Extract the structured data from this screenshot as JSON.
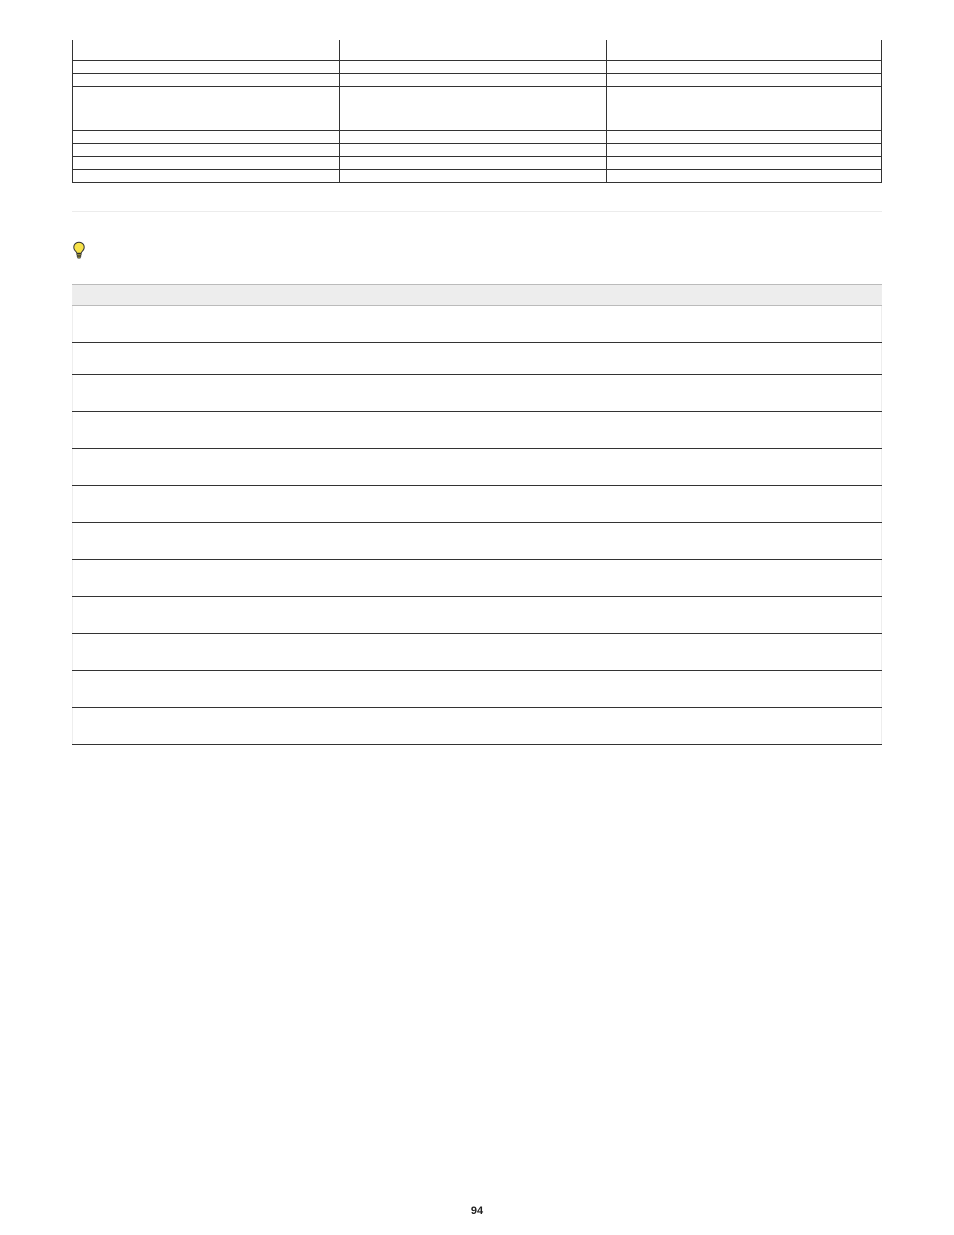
{
  "page_number": "94",
  "table1_rows": [
    {
      "c0": "",
      "c1": "",
      "c2": ""
    },
    {
      "c0": "",
      "c1": "",
      "c2": ""
    },
    {
      "c0": "",
      "c1": "",
      "c2": ""
    },
    {
      "c0": "",
      "c1": "",
      "c2": ""
    },
    {
      "c0": "",
      "c1": "",
      "c2": ""
    },
    {
      "c0": "",
      "c1": "",
      "c2": ""
    },
    {
      "c0": "",
      "c1": "",
      "c2": ""
    },
    {
      "c0": "",
      "c1": "",
      "c2": ""
    }
  ],
  "tip_text": "",
  "section_title": "",
  "table2_headers": {
    "h0": "",
    "h1": "",
    "h2": ""
  },
  "table2_rows": [
    {
      "c0": "",
      "c1": "",
      "c2": ""
    },
    {
      "c0": "",
      "c1": "",
      "c2": ""
    },
    {
      "c0": "",
      "c1": "",
      "c2": ""
    },
    {
      "c0": "",
      "c1": "",
      "c2": ""
    },
    {
      "c0": "",
      "c1": "",
      "c2": ""
    },
    {
      "c0": "",
      "c1": "",
      "c2": ""
    },
    {
      "c0": "",
      "c1": "",
      "c2": ""
    },
    {
      "c0": "",
      "c1": "",
      "c2": ""
    },
    {
      "c0": "",
      "c1": "",
      "c2": ""
    },
    {
      "c0": "",
      "c1": "",
      "c2": ""
    },
    {
      "c0": "",
      "c1": "",
      "c2": ""
    },
    {
      "c0": "",
      "c1": "",
      "c2": ""
    }
  ]
}
